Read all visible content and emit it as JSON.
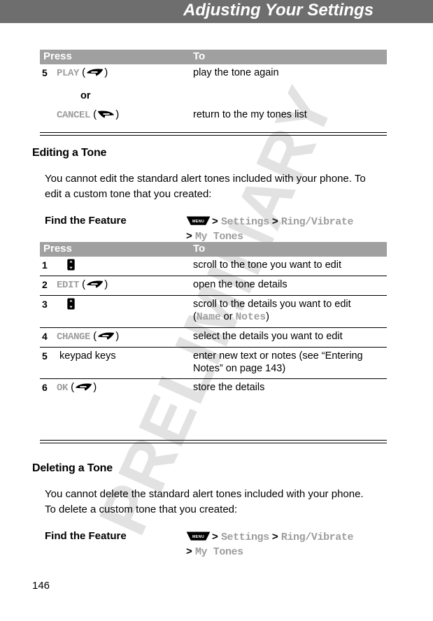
{
  "header": {
    "title": "Adjusting Your Settings",
    "bar_color": "#6e6e6e"
  },
  "watermark": {
    "text": "PRELIMINARY",
    "color": "#e2e2e2"
  },
  "page_number": "146",
  "table_header": {
    "press": "Press",
    "to": "To",
    "band_color": "#a0a0a0"
  },
  "ui_label_color": "#9d9d9d",
  "table_top": {
    "rows": [
      {
        "num": "5",
        "press_label": "PLAY",
        "press_key": "soft-right",
        "to": "play the tone again"
      },
      {
        "num": "",
        "press_label": "or",
        "press_key": "none",
        "to": ""
      },
      {
        "num": "",
        "press_label": "CANCEL",
        "press_key": "soft-left",
        "to": "return to the my tones list"
      }
    ]
  },
  "section_editing": {
    "heading": "Editing a Tone",
    "paragraph": "You cannot edit the standard alert tones included with your phone. To edit a custom tone that you created:",
    "find_the_feature_label": "Find the Feature",
    "path_line1": [
      "MENU",
      ">",
      "Settings",
      ">",
      "Ring/Vibrate"
    ],
    "path_line2": [
      ">",
      "My Tones"
    ]
  },
  "table_editing": {
    "rows": [
      {
        "num": "1",
        "press_key": "scroll",
        "press_label": "",
        "to_plain": "scroll to the tone you want to edit",
        "to_parts": []
      },
      {
        "num": "2",
        "press_key": "soft-right",
        "press_label": "EDIT",
        "to_plain": "open the tone details",
        "to_parts": []
      },
      {
        "num": "3",
        "press_key": "scroll",
        "press_label": "",
        "to_plain": "",
        "to_parts": [
          "scroll to the details you want to edit",
          "(",
          "Name",
          " or ",
          "Notes",
          ")"
        ]
      },
      {
        "num": "4",
        "press_key": "soft-right",
        "press_label": "CHANGE",
        "to_plain": "select the details you want to edit",
        "to_parts": []
      },
      {
        "num": "5",
        "press_key": "none",
        "press_label": "keypad keys",
        "to_plain": "enter new text or notes (see “Entering Notes” on page 143)",
        "to_parts": []
      },
      {
        "num": "6",
        "press_key": "soft-right",
        "press_label": "OK",
        "to_plain": "store the details",
        "to_parts": []
      }
    ]
  },
  "section_deleting": {
    "heading": "Deleting a Tone",
    "paragraph": "You cannot delete the standard alert tones included with your phone. To delete a custom tone that you created:",
    "find_the_feature_label": "Find the Feature",
    "path_line1": [
      "MENU",
      ">",
      "Settings",
      ">",
      "Ring/Vibrate"
    ],
    "path_line2": [
      ">",
      "My Tones"
    ]
  },
  "glyph_labels": {
    "menu_key": "MENU"
  }
}
